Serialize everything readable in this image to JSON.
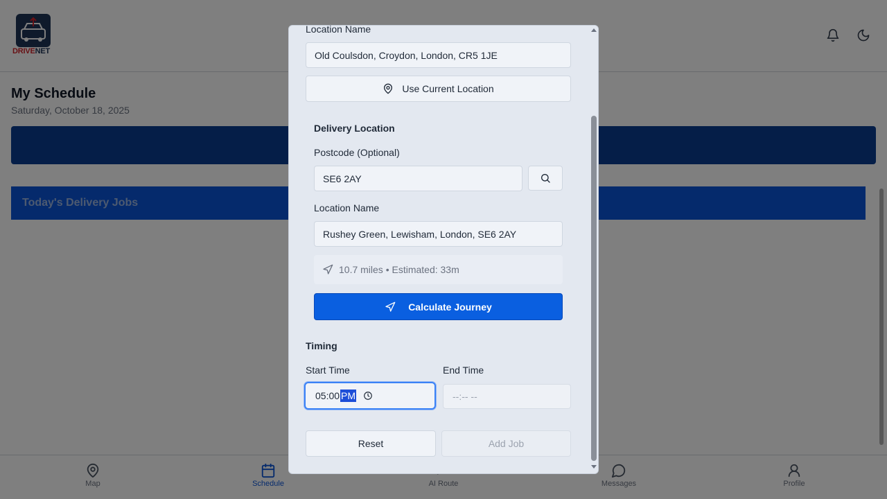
{
  "app": {
    "logo_drive": "DRIVE",
    "logo_net": "NET",
    "page_title": "My Schedule",
    "page_date": "Saturday, October 18, 2025",
    "jobs_section_title": "Today's Delivery Jobs"
  },
  "bottom_nav": [
    {
      "label": "Map",
      "icon": "map-pin-icon"
    },
    {
      "label": "Schedule",
      "icon": "calendar-icon",
      "active": true
    },
    {
      "label": "AI Route",
      "icon": "route-icon"
    },
    {
      "label": "Messages",
      "icon": "message-icon"
    },
    {
      "label": "Profile",
      "icon": "user-icon"
    }
  ],
  "modal": {
    "pickup": {
      "location_label": "Location Name",
      "location_value": "Old Coulsdon, Croydon, London, CR5 1JE",
      "use_current_label": "Use Current Location"
    },
    "delivery": {
      "section_title": "Delivery Location",
      "postcode_label": "Postcode (Optional)",
      "postcode_value": "SE6 2AY",
      "location_label": "Location Name",
      "location_value": "Rushey Green, Lewisham, London, SE6 2AY",
      "journey_info": "10.7 miles • Estimated: 33m",
      "calculate_label": "Calculate Journey"
    },
    "timing": {
      "section_title": "Timing",
      "start_label": "Start Time",
      "start_value_time": "05:00",
      "start_value_period": "PM",
      "end_label": "End Time",
      "end_placeholder": "--:-- --"
    },
    "actions": {
      "reset_label": "Reset",
      "add_job_label": "Add Job"
    }
  },
  "colors": {
    "primary": "#0a5fe0",
    "banner": "#0a3d91",
    "modal_bg": "#e3e8f0"
  }
}
